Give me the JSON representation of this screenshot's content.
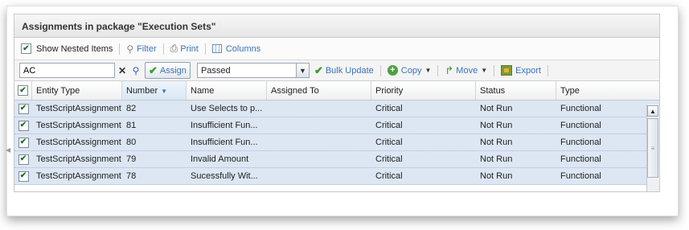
{
  "panel": {
    "title": "Assignments in package \"Execution Sets\""
  },
  "toolbar": {
    "show_nested_label": "Show Nested Items",
    "show_nested_checked": true,
    "filter_label": "Filter",
    "print_label": "Print",
    "columns_label": "Columns"
  },
  "actions": {
    "search_value": "AC",
    "clear_icon": "close-icon",
    "assign_label": "Assign",
    "status_value": "Passed",
    "bulk_update_label": "Bulk Update",
    "copy_label": "Copy",
    "move_label": "Move",
    "export_label": "Export"
  },
  "grid": {
    "columns": [
      "Entity Type",
      "Number",
      "Name",
      "Assigned To",
      "Priority",
      "Status",
      "Type"
    ],
    "sorted_column": "Number",
    "rows": [
      {
        "entity_type": "TestScriptAssignment",
        "number": "82",
        "name": "Use Selects to p...",
        "assigned_to": "",
        "priority": "Critical",
        "status": "Not Run",
        "type": "Functional"
      },
      {
        "entity_type": "TestScriptAssignment",
        "number": "81",
        "name": "Insufficient Fun...",
        "assigned_to": "",
        "priority": "Critical",
        "status": "Not Run",
        "type": "Functional"
      },
      {
        "entity_type": "TestScriptAssignment",
        "number": "80",
        "name": "Insufficient Fun...",
        "assigned_to": "",
        "priority": "Critical",
        "status": "Not Run",
        "type": "Functional"
      },
      {
        "entity_type": "TestScriptAssignment",
        "number": "79",
        "name": "Invalid Amount",
        "assigned_to": "",
        "priority": "Critical",
        "status": "Not Run",
        "type": "Functional"
      },
      {
        "entity_type": "TestScriptAssignment",
        "number": "78",
        "name": "Sucessfully Wit...",
        "assigned_to": "",
        "priority": "Critical",
        "status": "Not Run",
        "type": "Functional"
      }
    ]
  },
  "colors": {
    "row_selected": "#dde6f3",
    "link": "#3b73b9",
    "accent_green": "#3a9a2a"
  }
}
